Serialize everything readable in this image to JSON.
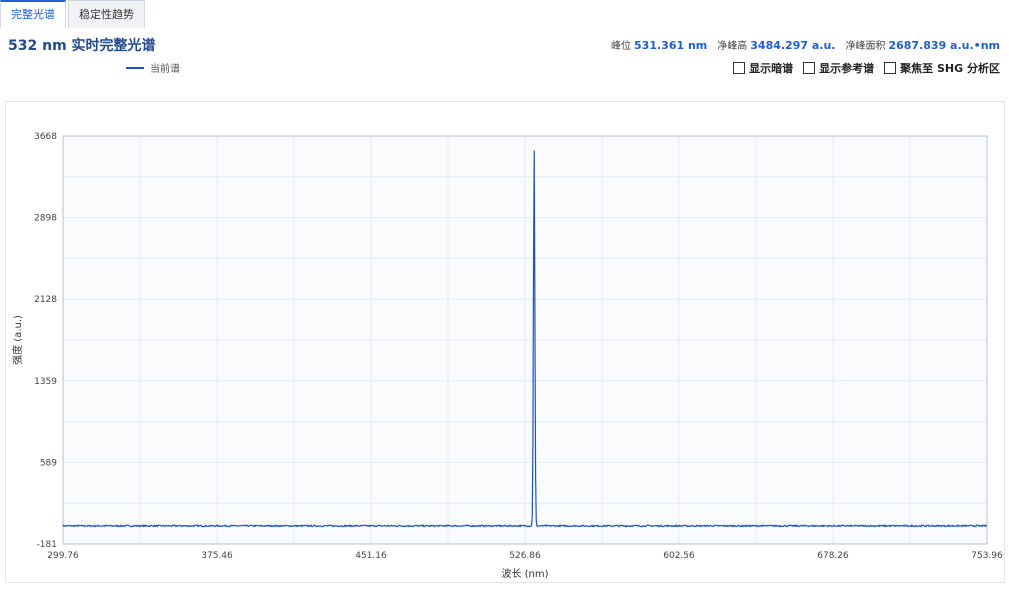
{
  "tabs": [
    {
      "label": "完整光谱",
      "active": true
    },
    {
      "label": "稳定性趋势",
      "active": false
    }
  ],
  "title": "532 nm 实时完整光谱",
  "legend": {
    "label": "当前谱",
    "color": "#1f4fd8"
  },
  "metrics": [
    {
      "label": "峰位",
      "value": "531.361 nm"
    },
    {
      "label": "净峰高",
      "value": "3484.297 a.u."
    },
    {
      "label": "净峰面积",
      "value": "2687.839 a.u.•nm"
    }
  ],
  "toggles": [
    {
      "label": "显示暗谱",
      "checked": false
    },
    {
      "label": "显示参考谱",
      "checked": false
    },
    {
      "label": "聚焦至 SHG 分析区",
      "checked": false
    }
  ],
  "chart_data": {
    "type": "line",
    "xlabel": "波长 (nm)",
    "ylabel": "强度 (a.u.)",
    "xlim": [
      299.76,
      753.96
    ],
    "ylim": [
      -181,
      3668
    ],
    "xticks": [
      "299.76",
      "375.46",
      "451.16",
      "526.86",
      "602.56",
      "678.26",
      "753.96"
    ],
    "yticks": [
      "-181",
      "589",
      "1359",
      "2128",
      "2898",
      "3668"
    ],
    "grid": true,
    "series": [
      {
        "name": "当前谱",
        "color": "#1f4fd8",
        "baseline": -10,
        "peak_x": 531.361,
        "peak_y": 3548,
        "peak_sigma": 0.35
      }
    ]
  }
}
